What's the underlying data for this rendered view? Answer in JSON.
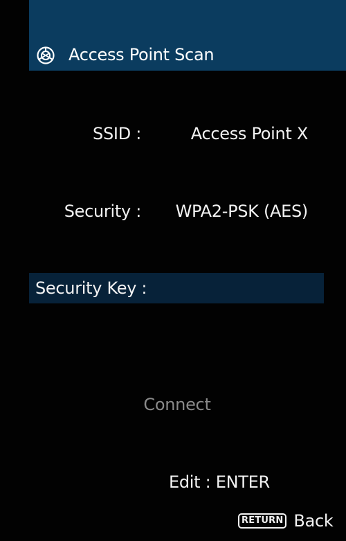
{
  "header": {
    "icon": "network-globe-icon",
    "title": "Access Point Scan"
  },
  "fields": {
    "ssid_label": "SSID :",
    "ssid_value": "Access Point X",
    "security_label": "Security :",
    "security_value": "WPA2-PSK (AES)",
    "security_key_label": "Security Key :"
  },
  "actions": {
    "connect_label": "Connect"
  },
  "footer": {
    "hint": "Edit : ENTER",
    "return_key": "RETURN",
    "back_label": "Back"
  },
  "colors": {
    "background": "#020202",
    "header_bg": "#0b3c5f",
    "highlight_row_bg": "#072239",
    "text": "#f2f2f2",
    "disabled_text": "#8a8a8a"
  }
}
